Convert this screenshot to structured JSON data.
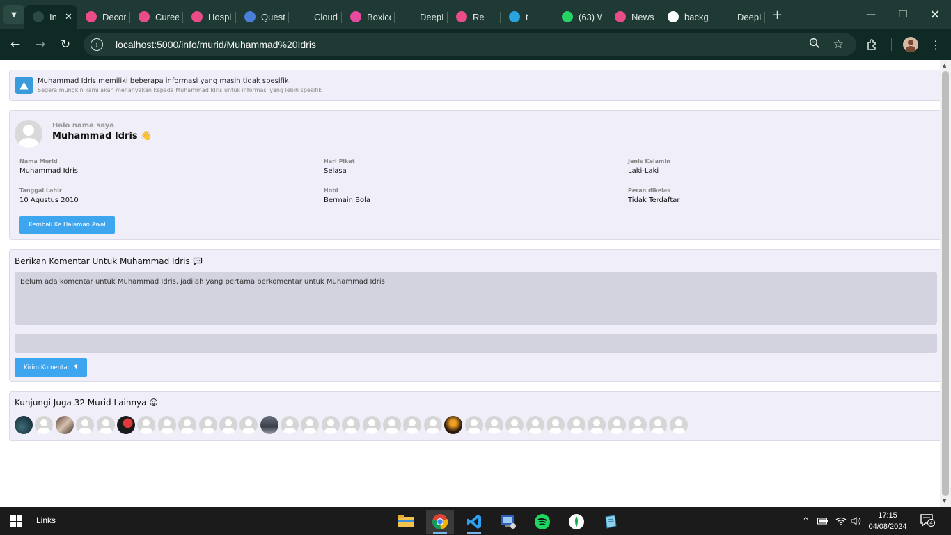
{
  "browser": {
    "tabs": [
      {
        "title": "In",
        "favicon": "link-icon",
        "color": "#2b4a44",
        "active": true
      },
      {
        "title": "Decor",
        "favicon": "dribbble-icon",
        "color": "#ea4c89"
      },
      {
        "title": "Curee",
        "favicon": "dribbble-icon",
        "color": "#ea4c89"
      },
      {
        "title": "Hospi",
        "favicon": "dribbble-icon",
        "color": "#ea4c89"
      },
      {
        "title": "Quest",
        "favicon": "flag-icon",
        "color": "#4a7fd8"
      },
      {
        "title": "Cloud",
        "favicon": "mongodb-leaf-icon",
        "color": "#1f3a35"
      },
      {
        "title": "Boxico",
        "favicon": "boxicons-icon",
        "color": "#e64ba0"
      },
      {
        "title": "DeepL",
        "favicon": "deepl-icon",
        "color": "#1f3a35"
      },
      {
        "title": "Re",
        "favicon": "dribbble-icon",
        "color": "#ea4c89"
      },
      {
        "title": "t",
        "favicon": "telegram-icon",
        "color": "#2aa3df"
      },
      {
        "title": "(63) W",
        "favicon": "whatsapp-icon",
        "color": "#25d366"
      },
      {
        "title": "News",
        "favicon": "dribbble-icon",
        "color": "#ea4c89"
      },
      {
        "title": "backg",
        "favicon": "google-icon",
        "color": "#ffffff"
      },
      {
        "title": "DeepL",
        "favicon": "deepl-icon",
        "color": "#1f3a35"
      }
    ],
    "url": "localhost:5000/info/murid/Muhammad%20Idris"
  },
  "alert": {
    "title": "Muhammad Idris memiliki beberapa informasi yang masih tidak spesifik",
    "subtitle": "Segera mungkin kami akan menanyakan kepada Muhammad Idris untuk informasi yang lebih spesifik"
  },
  "profile": {
    "greeting": "Halo nama saya",
    "name": "Muhammad Idris",
    "wave": "👋",
    "fields": [
      {
        "label": "Nama Murid",
        "value": "Muhammad Idris"
      },
      {
        "label": "Hari Piket",
        "value": "Selasa"
      },
      {
        "label": "Jenis Kelamin",
        "value": "Laki-Laki"
      },
      {
        "label": "Tanggal Lahir",
        "value": "10 Agustus 2010"
      },
      {
        "label": "Hobi",
        "value": "Bermain Bola"
      },
      {
        "label": "Peran dikelas",
        "value": "Tidak Terdaftar"
      }
    ],
    "back_button": "Kembali Ke Halaman Awal"
  },
  "comments": {
    "title": "Berikan Komentar Untuk Muhammad Idris",
    "empty_text": "Belum ada komentar untuk Muhammad Idris, jadilah yang pertama berkomentar untuk Muhammad Idris",
    "input_value": "",
    "submit_label": "Kirim Komentar"
  },
  "others": {
    "title": "Kunjungi Juga 32 Murid Lainnya",
    "emoji": "😛",
    "avatars": [
      "photo-night",
      "default",
      "photo-people",
      "default",
      "default",
      "photo-red",
      "default",
      "default",
      "default",
      "default",
      "default",
      "default",
      "photo-group",
      "default",
      "default",
      "default",
      "default",
      "default",
      "default",
      "default",
      "default",
      "photo-sunset",
      "default",
      "default",
      "default",
      "default",
      "default",
      "default",
      "default",
      "default",
      "default",
      "default",
      "default"
    ]
  },
  "taskbar": {
    "links_label": "Links",
    "time": "17:15",
    "date": "04/08/2024",
    "notifications": "4"
  },
  "colors": {
    "accent": "#3ea6ee",
    "card_bg": "#f0eef8",
    "chrome_bg": "#1f3a35"
  }
}
